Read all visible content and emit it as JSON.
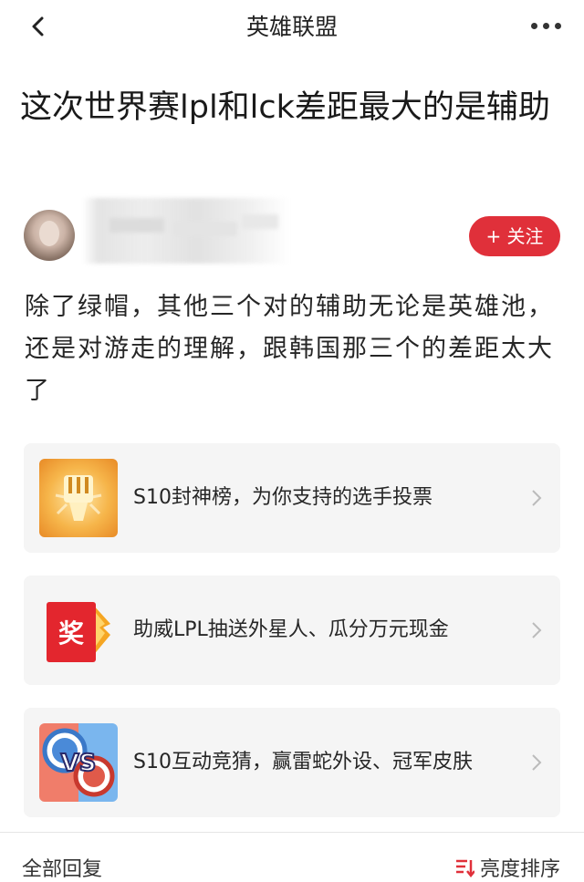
{
  "nav": {
    "title": "英雄联盟",
    "back_icon": "chevron-left-icon",
    "more_icon": "more-dots-icon"
  },
  "post": {
    "title": "这次世界赛lpl和lck差距最大的是辅助",
    "body": "除了绿帽，其他三个对的辅助无论是英雄池，还是对游走的理解，跟韩国那三个的差距太大了"
  },
  "author": {
    "follow_label": "+ 关注",
    "accent_color": "#e0303a"
  },
  "promo_cards": [
    {
      "label": "S10封神榜，为你支持的选手投票",
      "icon": "trophy-fork-icon"
    },
    {
      "label": "助威LPL抽送外星人、瓜分万元现金",
      "icon": "red-envelope-prize-icon"
    },
    {
      "label": "S10互动竞猜，赢雷蛇外设、冠军皮肤",
      "icon": "vs-chips-icon"
    }
  ],
  "footer": {
    "all_replies": "全部回复",
    "sort_label": "亮度排序",
    "sort_icon": "sort-icon"
  }
}
